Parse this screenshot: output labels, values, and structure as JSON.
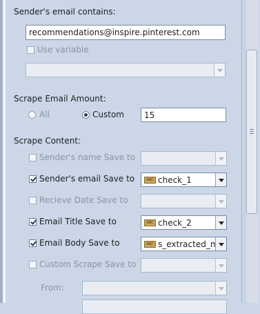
{
  "sender": {
    "heading": "Sender's email contains:",
    "email_value": "recommendations@inspire.pinterest.com",
    "use_variable_label": "Use variable",
    "use_variable_checked": false
  },
  "scrape_amount": {
    "heading": "Scrape Email Amount:",
    "options": [
      {
        "label": "All",
        "selected": false
      },
      {
        "label": "Custom",
        "selected": true
      }
    ],
    "custom_value": "15"
  },
  "scrape_content": {
    "heading": "Scrape Content:",
    "rows": [
      {
        "label": "Sender's name Save to",
        "checked": false,
        "variable": ""
      },
      {
        "label": "Sender's email Save to",
        "checked": true,
        "variable": "check_1"
      },
      {
        "label": "Recieve Date Save to",
        "checked": false,
        "variable": ""
      },
      {
        "label": "Email Title Save to",
        "checked": true,
        "variable": "check_2"
      },
      {
        "label": "Email Body Save to",
        "checked": true,
        "variable": "s_extracted_m"
      },
      {
        "label": "Custom Scrape Save to",
        "checked": false,
        "variable": ""
      }
    ],
    "from_label": "From:",
    "var_icon_text": "ABC"
  },
  "colors": {
    "panel_bg": "#cbd7e7",
    "variable_icon": "#c8a45e"
  }
}
